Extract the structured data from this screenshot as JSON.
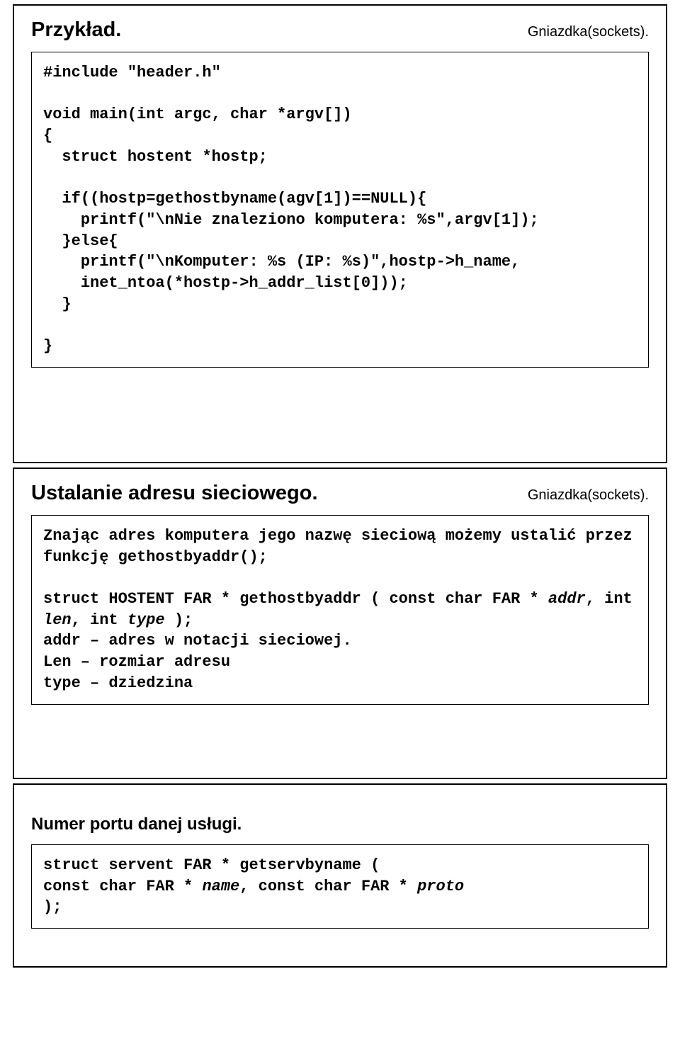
{
  "slides": [
    {
      "title": "Przykład.",
      "tag": "Gniazdka(sockets).",
      "code": "#include \"header.h\"\n\nvoid main(int argc, char *argv[])\n{\n  struct hostent *hostp;\n\n  if((hostp=gethostbyname(agv[1])==NULL){\n    printf(\"\\nNie znaleziono komputera: %s\",argv[1]);\n  }else{\n    printf(\"\\nKomputer: %s (IP: %s)\",hostp->h_name,\n    inet_ntoa(*hostp->h_addr_list[0]));\n  }\n\n}"
    },
    {
      "title": "Ustalanie adresu sieciowego.",
      "tag": "Gniazdka(sockets).",
      "text_intro": "Znając adres komputera jego nazwę sieciową możemy ustalić przez funkcję gethostbyaddr();",
      "proto_pre": "struct HOSTENT FAR * gethostbyaddr ( const char FAR * ",
      "proto_addr": "addr",
      "proto_mid1": ", int ",
      "proto_len": "len",
      "proto_mid2": ", int ",
      "proto_type": "type",
      "proto_end": " );",
      "desc1": "addr – adres w notacji sieciowej.",
      "desc2": "Len – rozmiar adresu",
      "desc3": "type – dziedzina"
    },
    {
      "title": "Numer portu danej usługi.",
      "line1_pre": "struct servent FAR * getservbyname (",
      "line2_pre": " const char FAR * ",
      "line2_name": "name",
      "line2_mid": ", const char FAR * ",
      "line2_proto": "proto",
      "line3": ");"
    }
  ]
}
